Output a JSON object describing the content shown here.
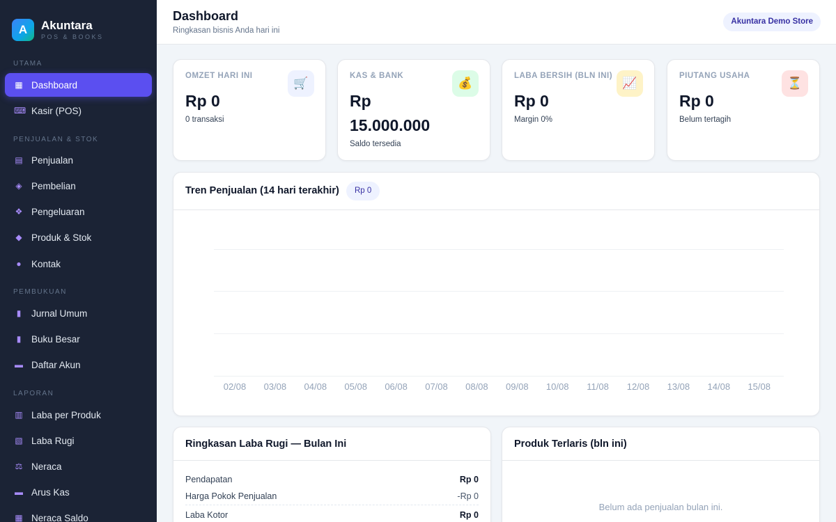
{
  "brand": {
    "logo_letter": "A",
    "name": "Akuntara",
    "sub": "POS & BOOKS"
  },
  "sidebar": {
    "sections": [
      {
        "title": "UTAMA",
        "items": [
          {
            "label": "Dashboard",
            "icon": "dashboard-icon",
            "glyph": "▦",
            "active": true
          },
          {
            "label": "Kasir (POS)",
            "icon": "keyboard-icon",
            "glyph": "⌨",
            "active": false
          }
        ]
      },
      {
        "title": "PENJUALAN & STOK",
        "items": [
          {
            "label": "Penjualan",
            "icon": "receipt-icon",
            "glyph": "▤"
          },
          {
            "label": "Pembelian",
            "icon": "package-icon",
            "glyph": "◈"
          },
          {
            "label": "Pengeluaran",
            "icon": "money-wings-icon",
            "glyph": "❖"
          },
          {
            "label": "Produk & Stok",
            "icon": "tag-icon",
            "glyph": "◆"
          },
          {
            "label": "Kontak",
            "icon": "people-icon",
            "glyph": "●"
          }
        ]
      },
      {
        "title": "PEMBUKUAN",
        "items": [
          {
            "label": "Jurnal Umum",
            "icon": "notebook-icon",
            "glyph": "▮"
          },
          {
            "label": "Buku Besar",
            "icon": "books-icon",
            "glyph": "▮"
          },
          {
            "label": "Daftar Akun",
            "icon": "folder-icon",
            "glyph": "▬"
          }
        ]
      },
      {
        "title": "LAPORAN",
        "items": [
          {
            "label": "Laba per Produk",
            "icon": "bar-chart-icon",
            "glyph": "▥"
          },
          {
            "label": "Laba Rugi",
            "icon": "trend-chart-icon",
            "glyph": "▧"
          },
          {
            "label": "Neraca",
            "icon": "balance-scale-icon",
            "glyph": "⚖"
          },
          {
            "label": "Arus Kas",
            "icon": "cash-icon",
            "glyph": "▬"
          },
          {
            "label": "Neraca Saldo",
            "icon": "abacus-icon",
            "glyph": "▦"
          }
        ]
      }
    ]
  },
  "header": {
    "title": "Dashboard",
    "subtitle": "Ringkasan bisnis Anda hari ini",
    "store": "Akuntara Demo Store"
  },
  "kpis": [
    {
      "label": "OMZET HARI INI",
      "value": "Rp 0",
      "note": "0 transaksi",
      "icon": "shopping-cart-icon",
      "glyph": "🛒",
      "icon_bg": "#eef2ff",
      "icon_color": "#6366f1"
    },
    {
      "label": "KAS & BANK",
      "value": "Rp 15.000.000",
      "note": "Saldo tersedia",
      "icon": "money-bag-icon",
      "glyph": "💰",
      "icon_bg": "#dcfce7",
      "icon_color": "#b45309"
    },
    {
      "label": "LABA BERSIH (BLN INI)",
      "value": "Rp 0",
      "note": "Margin 0%",
      "icon": "chart-up-icon",
      "glyph": "📈",
      "icon_bg": "#fef3c7",
      "icon_color": "#2563eb"
    },
    {
      "label": "PIUTANG USAHA",
      "value": "Rp 0",
      "note": "Belum tertagih",
      "icon": "hourglass-icon",
      "glyph": "⏳",
      "icon_bg": "#fee2e2",
      "icon_color": "#b45309"
    }
  ],
  "trend": {
    "title": "Tren Penjualan (14 hari terakhir)",
    "total": "Rp 0"
  },
  "chart_data": {
    "type": "line",
    "title": "Tren Penjualan (14 hari terakhir)",
    "categories": [
      "02/08",
      "03/08",
      "04/08",
      "05/08",
      "06/08",
      "07/08",
      "08/08",
      "09/08",
      "10/08",
      "11/08",
      "12/08",
      "13/08",
      "14/08",
      "15/08"
    ],
    "values": [
      0,
      0,
      0,
      0,
      0,
      0,
      0,
      0,
      0,
      0,
      0,
      0,
      0,
      0
    ],
    "grid": true
  },
  "profit_loss": {
    "title": "Ringkasan Laba Rugi — Bulan Ini",
    "rows": [
      {
        "label": "Pendapatan",
        "value": "Rp 0"
      },
      {
        "label": "Harga Pokok Penjualan",
        "value": "-Rp 0"
      },
      {
        "label": "Laba Kotor",
        "value": "Rp 0"
      }
    ]
  },
  "top_products": {
    "title": "Produk Terlaris (bln ini)",
    "empty": "Belum ada penjualan bulan ini."
  },
  "colors": {
    "sidebar_bg": "#1b2335",
    "accent": "#5b4ff0",
    "page_bg": "#f1f5f9"
  }
}
